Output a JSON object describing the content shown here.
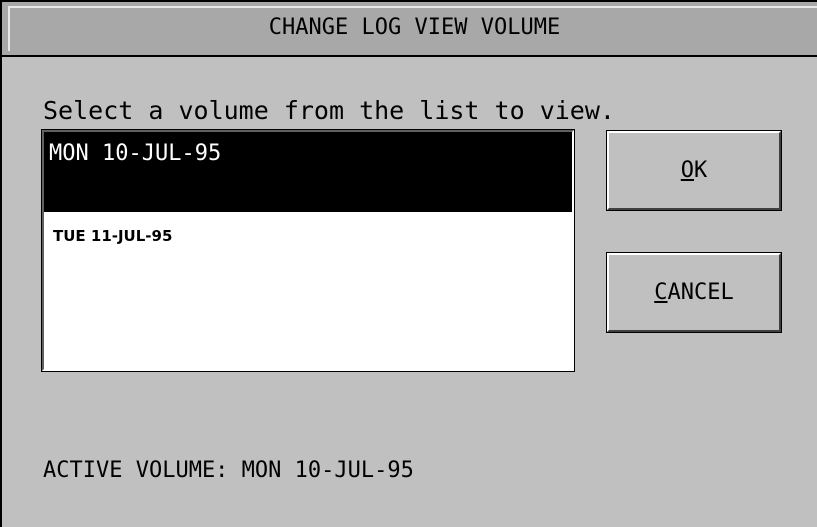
{
  "dialog": {
    "title": "CHANGE LOG VIEW VOLUME",
    "prompt": "Select a volume from the list to view."
  },
  "volume_list": {
    "items": [
      {
        "label": "MON 10-JUL-95",
        "selected": true
      },
      {
        "label": "TUE 11-JUL-95",
        "selected": false
      }
    ]
  },
  "buttons": {
    "ok": {
      "mnemonic": "O",
      "rest": "K"
    },
    "cancel": {
      "mnemonic": "C",
      "rest": "ANCEL"
    }
  },
  "status": {
    "active_volume": "ACTIVE VOLUME: MON 10-JUL-95"
  },
  "colors": {
    "background": "#c0c0c0",
    "titlebar": "#a8a8a8",
    "selection": "#000000",
    "list_background": "#ffffff"
  }
}
